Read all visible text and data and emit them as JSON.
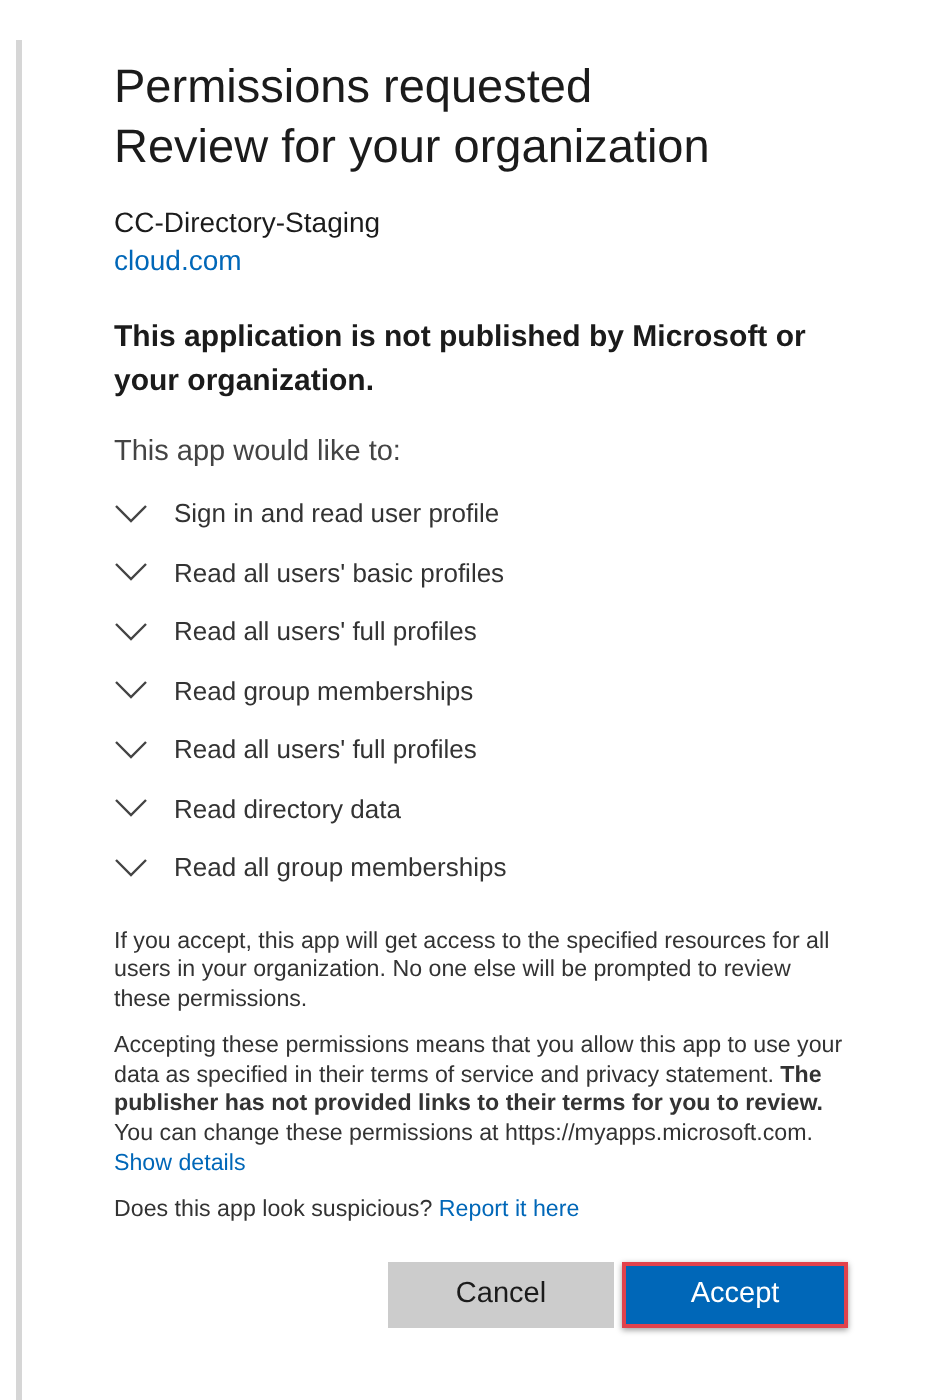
{
  "dialog": {
    "title_lines": [
      "Permissions requested",
      "Review for your organization"
    ],
    "app_name": "CC-Directory-Staging",
    "app_domain": "cloud.com",
    "warning": "This application is not published by Microsoft or your organization.",
    "intro": "This app would like to:",
    "permissions": [
      {
        "label": "Sign in and read user profile",
        "expanded": false
      },
      {
        "label": "Read all users' basic profiles",
        "expanded": false
      },
      {
        "label": "Read all users' full profiles",
        "expanded": false
      },
      {
        "label": "Read group memberships",
        "expanded": false
      },
      {
        "label": "Read all users' full profiles",
        "expanded": false
      },
      {
        "label": "Read directory data",
        "expanded": false
      },
      {
        "label": "Read all group memberships",
        "expanded": false
      }
    ],
    "notes": [
      {
        "text": "If you accept, this app will get access to the specified resources for all users in your organization. No one else will be prompted to review these permissions."
      },
      {
        "text": "Accepting these permissions means that you allow this app to use your data as specified in their terms of service and privacy statement. **The publisher has not provided links to their terms for you to review.** You can change these permissions at https://myapps.microsoft.com.",
        "link": "Show details"
      },
      {
        "text": "Does this app look suspicious?",
        "link": "Report it here"
      }
    ],
    "buttons": [
      {
        "label": "Cancel",
        "kind": "secondary",
        "focused": false
      },
      {
        "label": "Accept",
        "kind": "primary",
        "focused": true
      }
    ]
  }
}
